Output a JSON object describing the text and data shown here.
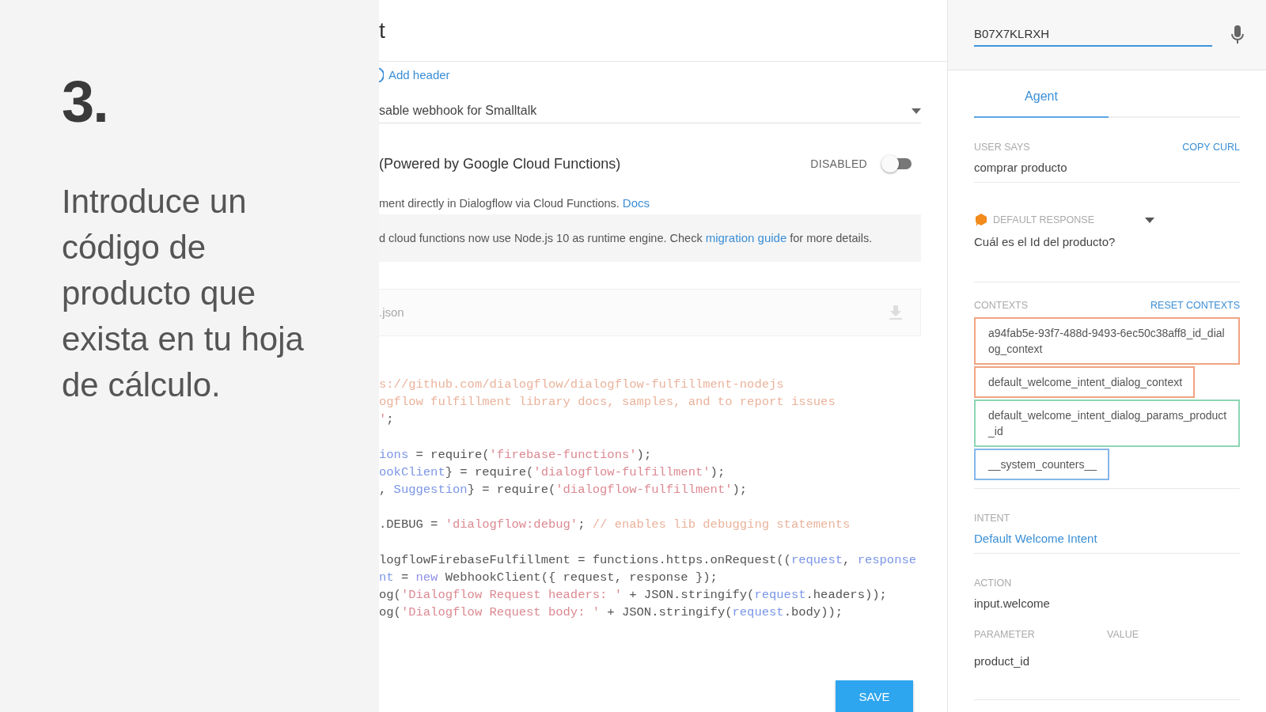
{
  "overlay": {
    "step": "3.",
    "lines": [
      "Introduce un",
      "código de",
      "producto que",
      "exista en tu hoja",
      "de cálculo."
    ]
  },
  "page": {
    "title": "t"
  },
  "headers": {
    "add_label": "Add header"
  },
  "smalltalk": {
    "value": "sable webhook for Smalltalk"
  },
  "inline_editor": {
    "title": "(Powered by Google Cloud Functions)",
    "state_label": "DISABLED",
    "enabled": false,
    "description": "ment directly in Dialogflow via Cloud Functions.",
    "docs_link": "Docs",
    "notice": "d cloud functions now use Node.js 10 as runtime engine. Check",
    "notice_link": "migration guide",
    "notice_end": "for more details.",
    "file_tab": ".json",
    "code": [
      {
        "kind": "code",
        "tokens": [
          {
            "kind": "comment",
            "text": "s://github.com/dialogflow/dialogflow-fulfillment-nodejs"
          }
        ]
      },
      {
        "kind": "code",
        "tokens": [
          {
            "kind": "comment",
            "text": "ogflow fulfillment library docs, samples, and to report issues"
          }
        ]
      },
      {
        "kind": "code",
        "tokens": [
          {
            "kind": "string",
            "text": "'"
          },
          {
            "kind": "plain",
            "text": ";"
          }
        ]
      },
      {
        "kind": "blank"
      },
      {
        "kind": "code",
        "tokens": [
          {
            "kind": "param",
            "text": "ions"
          },
          {
            "kind": "plain",
            "text": " = require("
          },
          {
            "kind": "string",
            "text": "'firebase-functions'"
          },
          {
            "kind": "plain",
            "text": ");"
          }
        ]
      },
      {
        "kind": "code",
        "tokens": [
          {
            "kind": "param",
            "text": "ookClient"
          },
          {
            "kind": "plain",
            "text": "} = require("
          },
          {
            "kind": "string",
            "text": "'dialogflow-fulfillment'"
          },
          {
            "kind": "plain",
            "text": ");"
          }
        ]
      },
      {
        "kind": "code",
        "tokens": [
          {
            "kind": "plain",
            "text": ", "
          },
          {
            "kind": "param",
            "text": "Suggestion"
          },
          {
            "kind": "plain",
            "text": "} = require("
          },
          {
            "kind": "string",
            "text": "'dialogflow-fulfillment'"
          },
          {
            "kind": "plain",
            "text": ");"
          }
        ]
      },
      {
        "kind": "blank"
      },
      {
        "kind": "code",
        "tokens": [
          {
            "kind": "plain",
            "text": ".DEBUG = "
          },
          {
            "kind": "string",
            "text": "'dialogflow:debug'"
          },
          {
            "kind": "plain",
            "text": "; "
          },
          {
            "kind": "comment",
            "text": "// enables lib debugging statements"
          }
        ]
      },
      {
        "kind": "blank"
      },
      {
        "kind": "code",
        "tokens": [
          {
            "kind": "plain",
            "text": "logflowFirebaseFulfillment = functions.https.onRequest(("
          },
          {
            "kind": "param",
            "text": "request"
          },
          {
            "kind": "plain",
            "text": ", "
          },
          {
            "kind": "param",
            "text": "response"
          }
        ]
      },
      {
        "kind": "code",
        "tokens": [
          {
            "kind": "param",
            "text": "nt"
          },
          {
            "kind": "plain",
            "text": " = "
          },
          {
            "kind": "keyword",
            "text": "new"
          },
          {
            "kind": "plain",
            "text": " WebhookClient({ request, response });"
          }
        ]
      },
      {
        "kind": "code",
        "tokens": [
          {
            "kind": "plain",
            "text": "og("
          },
          {
            "kind": "string",
            "text": "'Dialogflow Request headers: '"
          },
          {
            "kind": "plain",
            "text": " + JSON.stringify("
          },
          {
            "kind": "param",
            "text": "request"
          },
          {
            "kind": "plain",
            "text": ".headers));"
          }
        ]
      },
      {
        "kind": "code",
        "tokens": [
          {
            "kind": "plain",
            "text": "og("
          },
          {
            "kind": "string",
            "text": "'Dialogflow Request body: '"
          },
          {
            "kind": "plain",
            "text": " + JSON.stringify("
          },
          {
            "kind": "param",
            "text": "request"
          },
          {
            "kind": "plain",
            "text": ".body));"
          }
        ]
      }
    ],
    "save_button": "SAVE"
  },
  "console": {
    "query": "B07X7KLRXH",
    "tabs": [
      {
        "label": "Agent",
        "selected": true
      }
    ],
    "user_says_label": "USER SAYS",
    "copy_curl": "COPY CURL",
    "user_says": "comprar producto",
    "response_label": "DEFAULT RESPONSE",
    "response": "Cuál es el Id del producto?",
    "contexts_label": "CONTEXTS",
    "reset_contexts": "RESET CONTEXTS",
    "contexts": [
      {
        "name": "a94fab5e-93f7-488d-9493-6ec50c38aff8_id_dialog_context",
        "color": "#f0a482"
      },
      {
        "name": "default_welcome_intent_dialog_context",
        "color": "#f0a482"
      },
      {
        "name": "default_welcome_intent_dialog_params_product_id",
        "color": "#8cd6b4"
      },
      {
        "name": "__system_counters__",
        "color": "#86b6ea"
      }
    ],
    "intent_label": "INTENT",
    "intent": "Default Welcome Intent",
    "action_label": "ACTION",
    "action": "input.welcome",
    "parameter_label": "PARAMETER",
    "value_label": "VALUE",
    "parameter": "product_id"
  }
}
